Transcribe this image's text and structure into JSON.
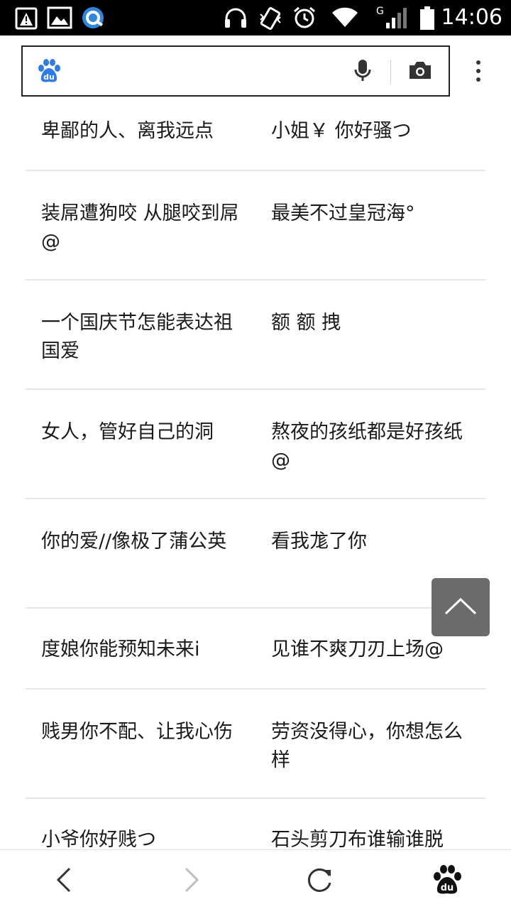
{
  "status_bar": {
    "time": "14:06",
    "icons": [
      "warning-upload-icon",
      "image-icon",
      "browser-app-icon",
      "headphones-icon",
      "vibrate-icon",
      "alarm-icon",
      "wifi-icon",
      "signal-icon",
      "battery-icon"
    ],
    "network_label": "G"
  },
  "search": {
    "value": "",
    "placeholder": "",
    "logo_icon": "baidu-paw-icon",
    "voice_icon": "microphone-icon",
    "camera_icon": "camera-icon"
  },
  "menu_icon": "more-vertical-icon",
  "rows": [
    {
      "left": "卑鄙的人、离我远点",
      "right": "小姐￥ 你好骚つ"
    },
    {
      "left": "装屌遭狗咬 从腿咬到屌@",
      "right": "最美不过皇冠海°"
    },
    {
      "left": "一个国庆节怎能表达祖国爱",
      "right": "额 额 拽"
    },
    {
      "left": "女人，管好自己的洞",
      "right": "熬夜的孩纸都是好孩纸@"
    },
    {
      "left": "你的爱//像极了蒲公英",
      "right": "看我尨了你"
    },
    {
      "left": "度娘你能预知未来i",
      "right": "见谁不爽刀刃上场@"
    },
    {
      "left": "贱男你不配、让我心伤",
      "right": "劳资没得心，你想怎么样"
    },
    {
      "left": "小爷你好贱つ",
      "right": "石头剪刀布谁输谁脱"
    }
  ],
  "back_to_top_icon": "chevron-up-icon",
  "bottom_nav": {
    "back_icon": "chevron-left-icon",
    "forward_icon": "chevron-right-icon",
    "refresh_icon": "refresh-icon",
    "home_icon": "baidu-paw-icon"
  },
  "colors": {
    "status_bar_bg": "#000000",
    "baidu_blue": "#2e7be6",
    "divider": "#e6e6e6",
    "to_top_bg": "#6b6b6b"
  }
}
